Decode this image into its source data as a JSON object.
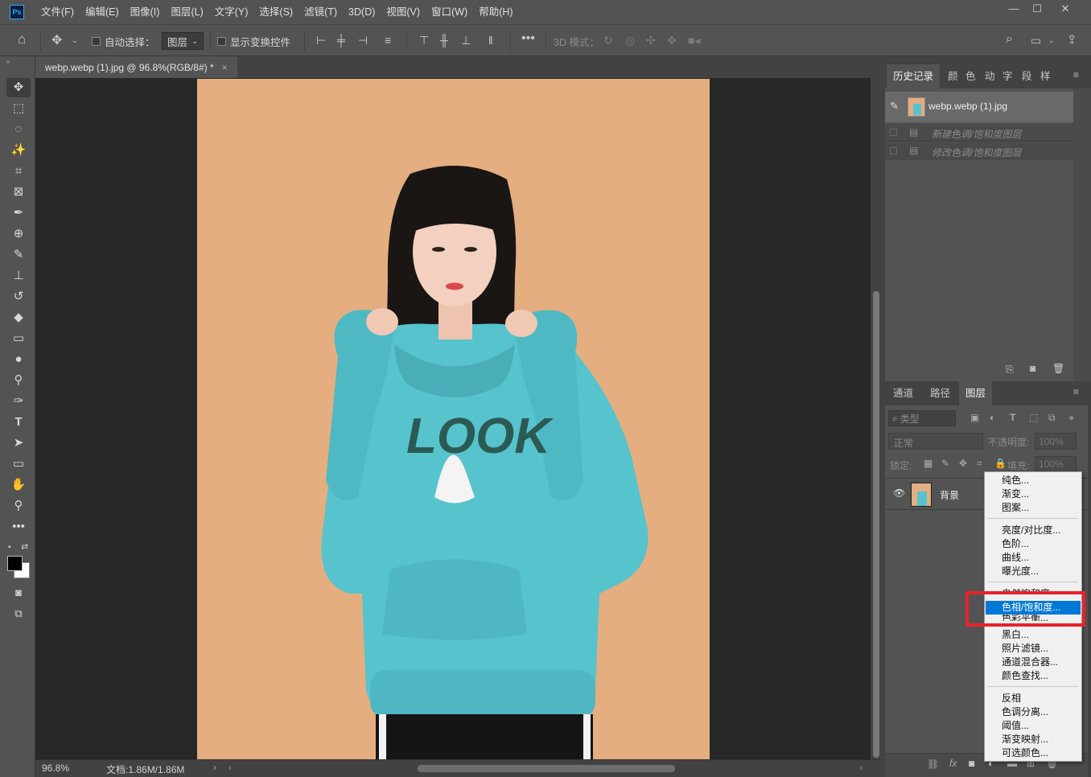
{
  "app": {
    "logo": "Ps"
  },
  "menu": [
    "文件(F)",
    "编辑(E)",
    "图像(I)",
    "图层(L)",
    "文字(Y)",
    "选择(S)",
    "滤镜(T)",
    "3D(D)",
    "视图(V)",
    "窗口(W)",
    "帮助(H)"
  ],
  "window_controls": {
    "minimize": "—",
    "restore": "☐",
    "close": "✕"
  },
  "options_bar": {
    "auto_select_label": "自动选择：",
    "auto_select_target": "图层",
    "show_transform_label": "显示变换控件",
    "mode_3d_label": "3D 模式："
  },
  "document": {
    "tab_title": "webp.webp (1).jpg @ 96.8%(RGB/8#) *",
    "close": "×",
    "zoom": "96.8%",
    "doc_size": "文档:1.86M/1.86M",
    "print_text": "LOOK"
  },
  "history_panel": {
    "tabs": [
      "历史记录",
      "颜",
      "色",
      "动",
      "字",
      "段",
      "样"
    ],
    "snapshot": "webp.webp (1).jpg",
    "states": [
      "新建色调/饱和度图层",
      "修改色调/饱和度图层"
    ]
  },
  "layers_panel": {
    "tabs": [
      "通道",
      "路径",
      "图层"
    ],
    "filter_label": "类型",
    "blend_mode": "正常",
    "opacity_label": "不透明度:",
    "opacity_value": "100%",
    "lock_label": "锁定:",
    "fill_label": "填充:",
    "fill_value": "100%",
    "layer_name": "背景"
  },
  "adjustment_menu": {
    "groups": [
      [
        "纯色...",
        "渐变...",
        "图案..."
      ],
      [
        "亮度/对比度...",
        "色阶...",
        "曲线...",
        "曝光度..."
      ],
      [
        "自然饱和度...",
        "色相/饱和度...",
        "色彩平衡...",
        "黑白...",
        "照片滤镜...",
        "通道混合器...",
        "颜色查找..."
      ],
      [
        "反相",
        "色调分离...",
        "阈值...",
        "渐变映射...",
        "可选颜色..."
      ]
    ],
    "highlighted": "色相/饱和度..."
  },
  "colors": {
    "accent": "#0078d7",
    "highlight_box": "#e8222a",
    "backdrop": "#e4ae80",
    "hoodie": "#57c3cc"
  }
}
